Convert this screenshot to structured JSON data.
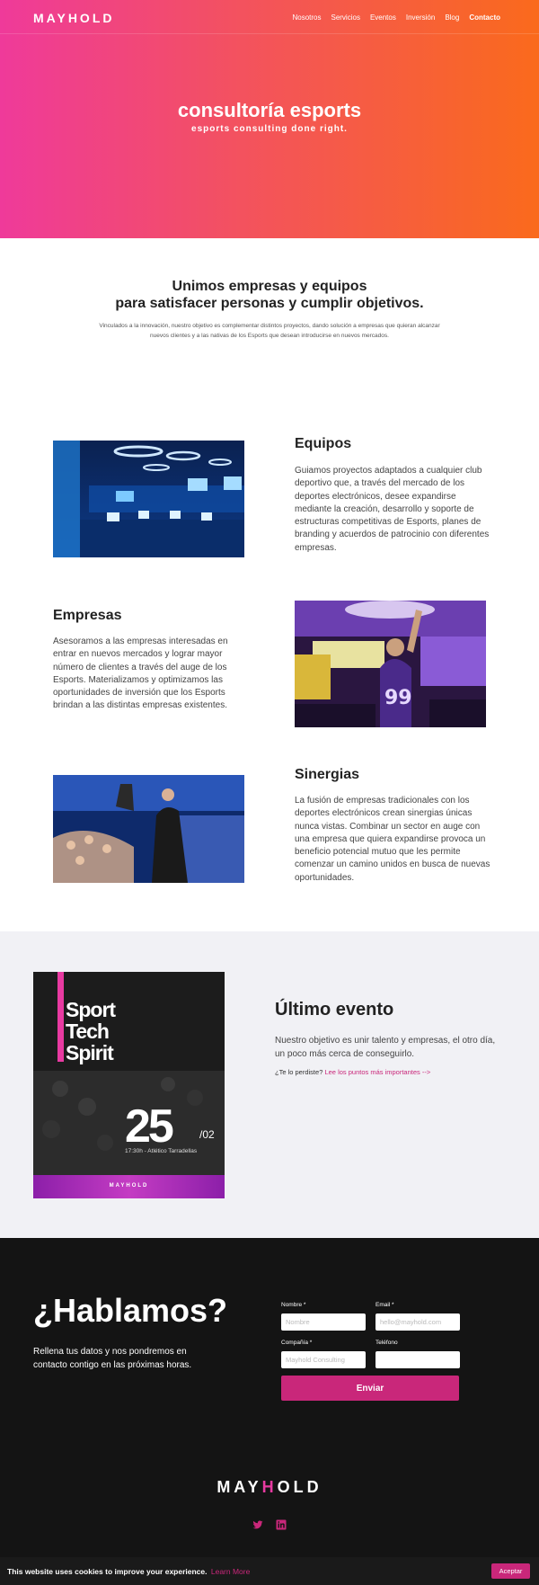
{
  "brand": {
    "logo": "MAYHOLD",
    "logo_parts": [
      "MAY",
      "H",
      "OLD"
    ]
  },
  "nav": {
    "items": [
      "Nosotros",
      "Servicios",
      "Eventos",
      "Inversión",
      "Blog",
      "Contacto"
    ]
  },
  "hero": {
    "title": "consultoría esports",
    "subtitle": "esports consulting done right."
  },
  "intro": {
    "heading_line1": "Unimos empresas y equipos",
    "heading_line2": "para satisfacer personas y cumplir objetivos.",
    "text": "Vinculados a la innovación, nuestro objetivo es complementar distintos proyectos, dando solución a empresas que quieran alcanzar nuevos clientes y a las nativas de los Esports que desean introducirse en nuevos mercados."
  },
  "features": [
    {
      "title": "Equipos",
      "text": "Guiamos proyectos adaptados a cualquier club deportivo que, a través del mercado de los deportes electrónicos, desee expandirse mediante la creación, desarrollo y soporte de estructuras competitivas de Esports, planes de branding y acuerdos de patrocinio con diferentes empresas."
    },
    {
      "title": "Empresas",
      "text": "Asesoramos a las empresas interesadas en entrar en nuevos mercados y lograr mayor número de clientes a través del auge de los Esports. Materializamos y optimizamos las oportunidades de inversión que los Esports brindan a las distintas empresas existentes."
    },
    {
      "title": "Sinergias",
      "text": "La fusión de empresas tradicionales con los deportes electrónicos crean sinergias únicas nunca vistas. Combinar un sector en auge con una empresa que quiera expandirse provoca un beneficio potencial mutuo que les permite comenzar un camino unidos en busca de nuevas oportunidades."
    }
  ],
  "event": {
    "title": "Último evento",
    "text": "Nuestro objetivo es unir talento y empresas, el otro día, un poco más cerca de conseguirlo.",
    "link_prefix": "¿Te lo perdiste?",
    "link_label": "Lee los puntos más importantes -->",
    "poster": {
      "title_lines": [
        "Sport",
        "Tech",
        "Spirit"
      ],
      "day": "25",
      "month": "/02",
      "place": "17:30h - Atlético Tarradellas",
      "brand": "MAYHOLD"
    }
  },
  "contact": {
    "title": "¿Hablamos?",
    "text": "Rellena tus datos y nos pondremos en contacto contigo en las próximas horas.",
    "fields": {
      "nombre": {
        "label": "Nombre *",
        "placeholder": "Nombre"
      },
      "email": {
        "label": "Email *",
        "placeholder": "hello@mayhold.com"
      },
      "compania": {
        "label": "Compañía *",
        "placeholder": "Mayhold Consulting"
      },
      "telefono": {
        "label": "Teléfono",
        "placeholder": ""
      }
    },
    "submit": "Enviar"
  },
  "social": [
    "twitter-icon",
    "linkedin-icon"
  ],
  "cookie": {
    "text": "This website uses cookies to improve your experience.",
    "link": "Learn More",
    "accept": "Aceptar"
  },
  "colors": {
    "accent": "#c9277a",
    "gradient_start": "#ef3a9a",
    "gradient_end": "#fa6a1c",
    "dark": "#141414",
    "light_bg": "#f1f1f5"
  }
}
